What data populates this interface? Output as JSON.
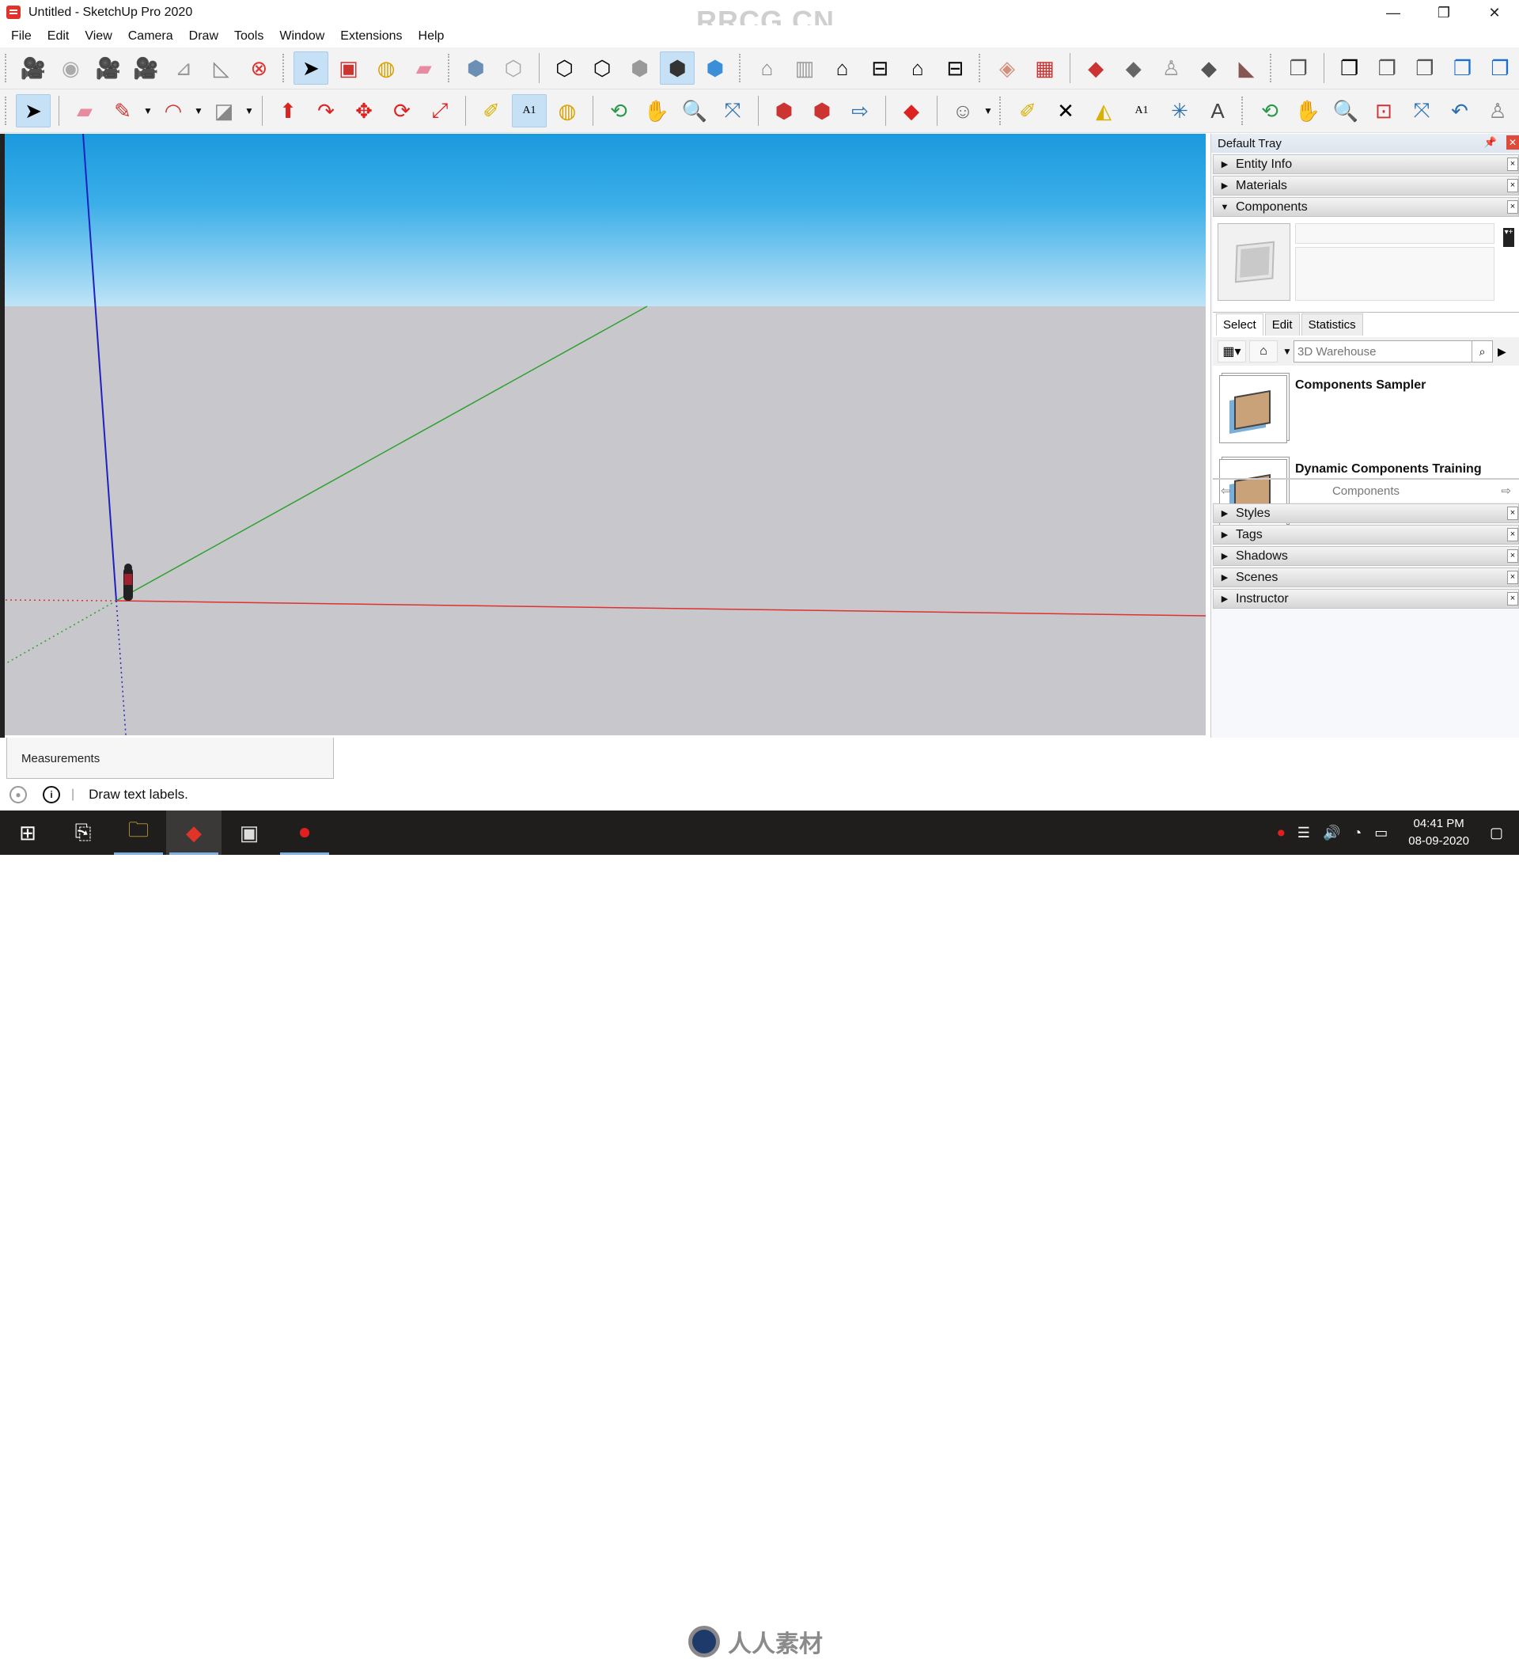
{
  "window": {
    "title": "Untitled - SketchUp Pro 2020",
    "watermark": "RRCG.CN",
    "minimize": "—",
    "restore": "❐",
    "close": "✕"
  },
  "menu": [
    "File",
    "Edit",
    "View",
    "Camera",
    "Draw",
    "Tools",
    "Window",
    "Extensions",
    "Help"
  ],
  "toolbar_row1": [
    {
      "group": "camera",
      "items": [
        "add-camera-icon",
        "look-around-icon",
        "position-camera-icon",
        "walk-icon",
        "section-plane-icon",
        "section-fill-icon",
        "delete-camera-icon"
      ]
    },
    {
      "group": "select",
      "items": [
        "select-icon",
        "make-component-icon",
        "paint-bucket-icon",
        "eraser-icon"
      ]
    },
    {
      "group": "views-style",
      "items": [
        "xray-icon",
        "back-edges-icon",
        "wireframe-icon",
        "hidden-line-icon",
        "shaded-icon",
        "shaded-textures-icon",
        "monochrome-icon"
      ]
    },
    {
      "group": "views",
      "items": [
        "iso-view-icon",
        "top-view-icon",
        "front-view-icon",
        "right-view-icon",
        "back-view-icon",
        "left-view-icon"
      ]
    },
    {
      "group": "sandbox",
      "items": [
        "sandbox-contours-icon",
        "sandbox-scratch-icon",
        "smoove-icon",
        "stamp-icon",
        "drape-icon",
        "add-detail-icon",
        "flip-edge-icon"
      ]
    },
    {
      "group": "solid",
      "items": [
        "outer-shell-icon",
        "intersect-icon",
        "union-icon",
        "subtract-icon",
        "trim-icon",
        "split-icon"
      ]
    }
  ],
  "toolbar_row2": [
    "select-icon",
    "eraser-icon",
    "pencil-icon",
    "arc-icon",
    "rectangle-icon",
    "push-pull-icon",
    "follow-me-icon",
    "move-icon",
    "rotate-icon",
    "scale-icon",
    "tape-measure-icon",
    "text-icon",
    "paint-bucket-icon",
    "orbit-icon",
    "pan-icon",
    "zoom-icon",
    "zoom-extents-icon",
    "3d-warehouse-icon",
    "extension-warehouse-icon",
    "layout-icon",
    "ruby-console-icon",
    "account-icon",
    "tape-measure-icon",
    "protractor-dim-icon",
    "protractor-icon",
    "3d-text-icon",
    "axes-icon",
    "3d-text-tool-icon",
    "orbit-icon",
    "pan-icon",
    "zoom-icon",
    "zoom-window-icon",
    "zoom-extents-icon",
    "previous-view-icon",
    "walk-icon"
  ],
  "active_tool": "text",
  "status": {
    "message": "Draw text labels.",
    "measurements_label": "Measurements"
  },
  "tray": {
    "title": "Default Tray",
    "panels_top": [
      {
        "label": "Entity Info",
        "expanded": false
      },
      {
        "label": "Materials",
        "expanded": false
      },
      {
        "label": "Components",
        "expanded": true
      }
    ],
    "components": {
      "tabs": [
        "Select",
        "Edit",
        "Statistics"
      ],
      "active_tab": "Select",
      "search_placeholder": "3D Warehouse",
      "items": [
        "Components Sampler",
        "Dynamic Components Training"
      ],
      "nav_label": "Components"
    },
    "panels_bottom": [
      {
        "label": "Styles"
      },
      {
        "label": "Tags"
      },
      {
        "label": "Shadows"
      },
      {
        "label": "Scenes"
      },
      {
        "label": "Instructor"
      }
    ]
  },
  "colors": {
    "sky_top": "#1b9ade",
    "ground": "#c8c8cc",
    "axis_red": "#e03030",
    "axis_green": "#2da02d",
    "axis_blue": "#2020c0"
  },
  "taskbar": {
    "clock_time": "04:41 PM",
    "clock_date": "08-09-2020",
    "watermark": "人人素材"
  }
}
